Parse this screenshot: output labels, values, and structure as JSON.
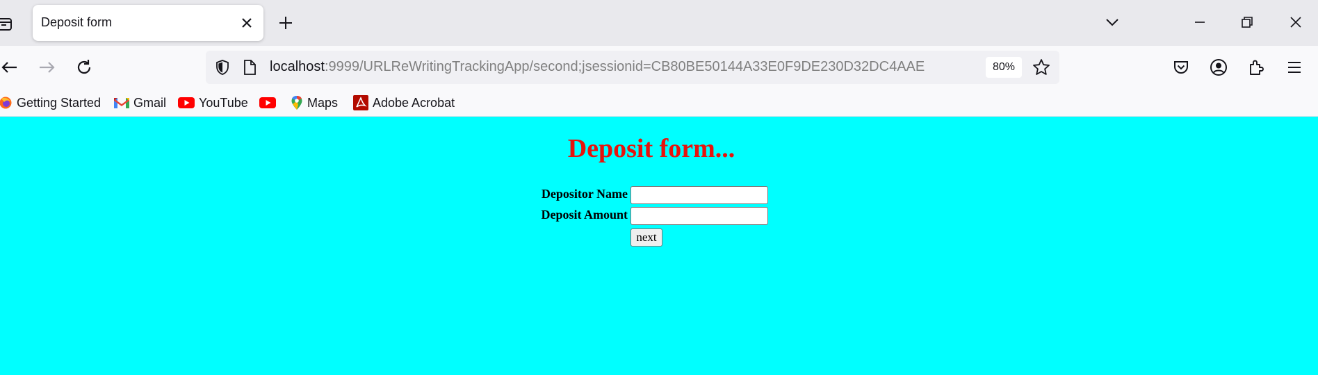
{
  "browser": {
    "tab": {
      "title": "Deposit form"
    },
    "url": {
      "host": "localhost",
      "path": ":9999/URLReWritingTrackingApp/second;jsessionid=CB80BE50144A33E0F9DE230D32DC4AAE"
    },
    "zoom": "80%",
    "bookmarks": [
      {
        "label": "Getting Started",
        "icon": "firefox-icon"
      },
      {
        "label": "Gmail",
        "icon": "gmail-icon"
      },
      {
        "label": "YouTube",
        "icon": "youtube-icon"
      },
      {
        "label": "",
        "icon": "youtube-icon"
      },
      {
        "label": "Maps",
        "icon": "maps-icon"
      },
      {
        "label": "Adobe Acrobat",
        "icon": "acrobat-icon"
      }
    ]
  },
  "page": {
    "heading": "Deposit form...",
    "background": "#00ffff",
    "heading_color": "#e8120c",
    "fields": [
      {
        "label": "Depositor Name",
        "value": ""
      },
      {
        "label": "Deposit Amount",
        "value": ""
      }
    ],
    "submit_label": "next"
  }
}
